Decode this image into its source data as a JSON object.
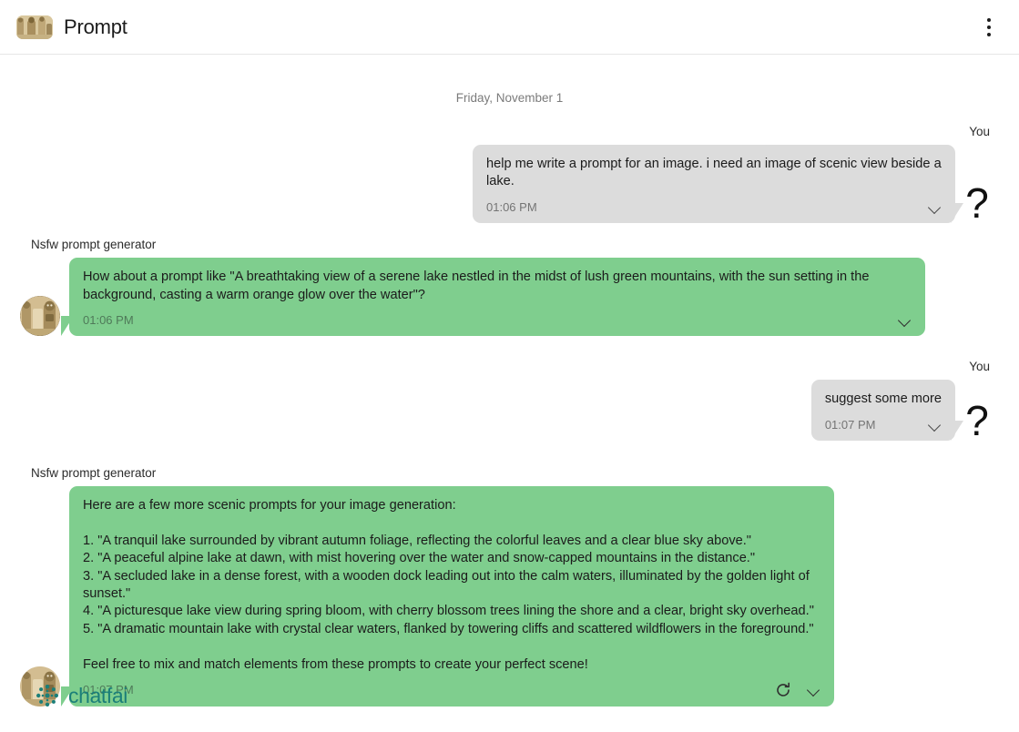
{
  "header": {
    "title": "Prompt",
    "avatar_name": "character-avatar",
    "menu_label": "more-options"
  },
  "conversation": {
    "date_separator": "Friday, November 1",
    "user_name": "You",
    "bot_name": "Nsfw prompt generator",
    "messages": [
      {
        "role": "user",
        "sender": "You",
        "text": "help me write a prompt for an image. i need an image of scenic view beside a lake.",
        "time": "01:06 PM",
        "avatar_glyph": "?"
      },
      {
        "role": "bot",
        "sender": "Nsfw prompt generator",
        "text": "How about a prompt like \"A breathtaking view of a serene lake nestled in the midst of lush green mountains, with the sun setting in the background, casting a warm orange glow over the water\"?",
        "time": "01:06 PM"
      },
      {
        "role": "user",
        "sender": "You",
        "text": "suggest some more",
        "time": "01:07 PM",
        "avatar_glyph": "?"
      },
      {
        "role": "bot",
        "sender": "Nsfw prompt generator",
        "text": "Here are a few more scenic prompts for your image generation:\n\n1. \"A tranquil lake surrounded by vibrant autumn foliage, reflecting the colorful leaves and a clear blue sky above.\"\n2. \"A peaceful alpine lake at dawn, with mist hovering over the water and snow-capped mountains in the distance.\"\n3. \"A secluded lake in a dense forest, with a wooden dock leading out into the calm waters, illuminated by the golden light of sunset.\"\n4. \"A picturesque lake view during spring bloom, with cherry blossom trees lining the shore and a clear, bright sky overhead.\"\n5. \"A dramatic mountain lake with crystal clear waters, flanked by towering cliffs and scattered wildflowers in the foreground.\"\n\nFeel free to mix and match elements from these prompts to create your perfect scene!",
        "time": "01:07 PM",
        "has_regenerate": true
      }
    ]
  },
  "brand": {
    "name": "chatfai",
    "color": "#1b7f79"
  },
  "colors": {
    "user_bubble": "#dcdcdc",
    "bot_bubble": "#7fce8e",
    "brand_teal": "#1b7f79",
    "page_background": "#ffffff"
  }
}
